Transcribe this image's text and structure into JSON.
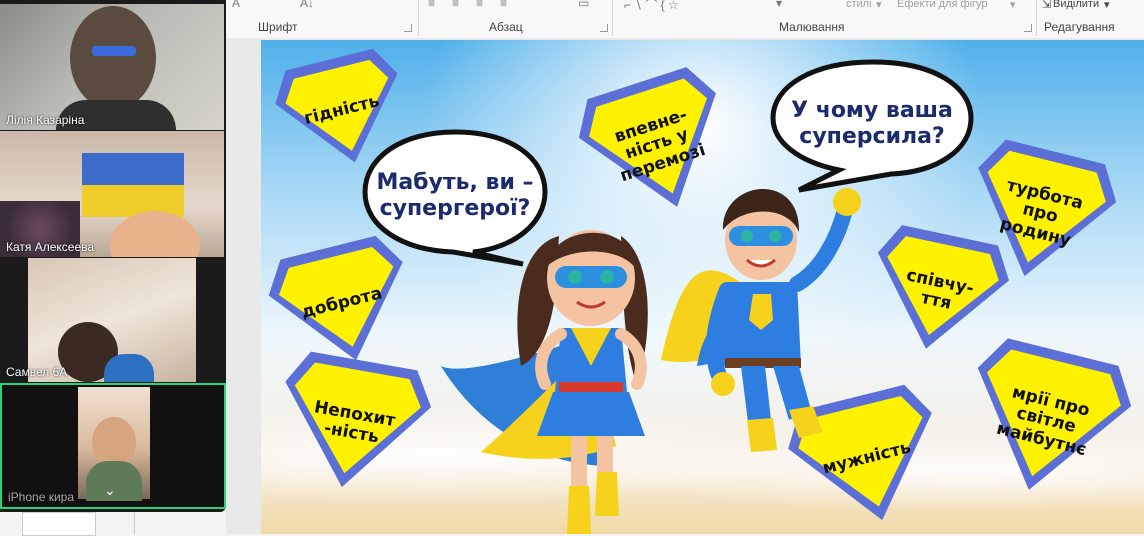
{
  "ribbon": {
    "groups": {
      "font": "Шрифт",
      "paragraph": "Абзац",
      "drawing": "Малювання",
      "editing": "Редагування"
    },
    "styles_label": "стилі",
    "effects_label": "Ефекти для фігур",
    "select_label": "Виділити"
  },
  "participants": [
    {
      "name": "Лілія Казаріна"
    },
    {
      "name": "Катя Алексеева"
    },
    {
      "name": "Самвел 6А"
    },
    {
      "name": "iPhone кира"
    }
  ],
  "slide": {
    "bubble_left": "Мабуть, ви –\nсупергерої?",
    "bubble_right": "У чому ваша\nсуперсила?",
    "shields": [
      {
        "text": "гідність"
      },
      {
        "text": "впевне-\nність у\nперемозі"
      },
      {
        "text": "турбота\nпро\nродину"
      },
      {
        "text": "доброта"
      },
      {
        "text": "співчу-\nття"
      },
      {
        "text": "Непохит\n-ність"
      },
      {
        "text": "мужність"
      },
      {
        "text": "мрії про\nсвітле\nмайбутнє"
      }
    ]
  },
  "colors": {
    "shield_fill": "#fff200",
    "shield_border": "#5b6fd6",
    "hero_blue": "#1f6fd1",
    "hero_yellow": "#f7d21a"
  }
}
